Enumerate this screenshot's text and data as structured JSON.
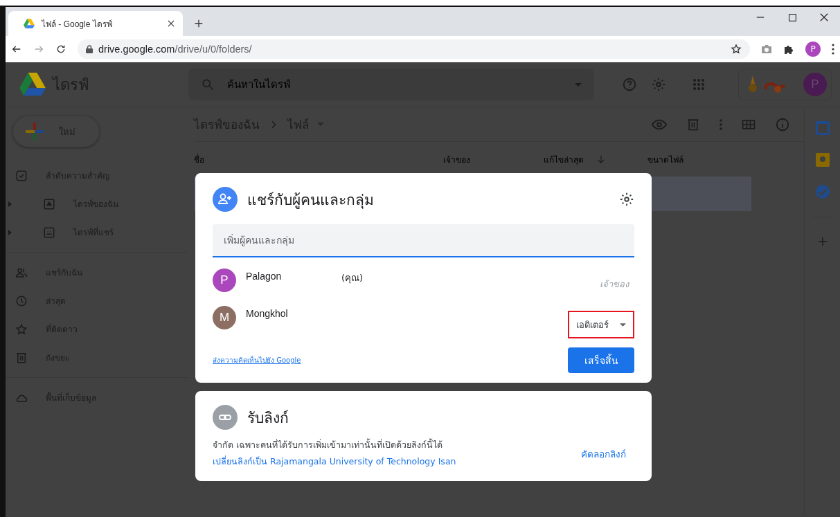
{
  "browser": {
    "tab_title": "ไฟล์ - Google ไดรฟ์",
    "url_host": "drive.google.com",
    "url_path": "/drive/u/0/folders/",
    "profile_initial": "P"
  },
  "app": {
    "logo_text": "ไดรฟ์",
    "search_placeholder": "ค้นหาในไดรฟ์",
    "account_initial": "P"
  },
  "new_button": "ใหม่",
  "sidebar": [
    [
      {
        "label": "ลำดับความสำคัญ",
        "kind": "priority",
        "expandable": false
      },
      {
        "label": "ไดรฟ์ของฉัน",
        "kind": "mydrive",
        "expandable": true
      },
      {
        "label": "ไดรฟ์ที่แชร์",
        "kind": "shared-drive",
        "expandable": true
      }
    ],
    [
      {
        "label": "แชร์กับฉัน",
        "kind": "people",
        "expandable": false
      },
      {
        "label": "ล่าสุด",
        "kind": "clock",
        "expandable": false
      },
      {
        "label": "ที่ติดดาว",
        "kind": "star",
        "expandable": false
      },
      {
        "label": "ถังขยะ",
        "kind": "trash",
        "expandable": false
      }
    ],
    [
      {
        "label": "พื้นที่เก็บข้อมูล",
        "kind": "cloud",
        "expandable": false
      }
    ]
  ],
  "breadcrumb": [
    "ไดรฟ์ของฉัน",
    "ไฟล์"
  ],
  "columns": [
    {
      "label": "ชื่อ",
      "sorted": false
    },
    {
      "label": "เจ้าของ",
      "sorted": false
    },
    {
      "label": "แก้ไขล่าสุด",
      "sorted": true
    },
    {
      "label": "ขนาดไฟล์",
      "sorted": false
    }
  ],
  "rows": [
    {
      "selected": true
    }
  ],
  "share_dialog": {
    "title": "แชร์กับผู้คนและกลุ่ม",
    "placeholder": "เพิ่มผู้คนและกลุ่ม",
    "people": [
      {
        "initial": "P",
        "name": "Palagon",
        "note": "(คุณ)",
        "color": "#ab47bc",
        "role": "เจ้าของ",
        "kind": "label",
        "highlighted": false
      },
      {
        "initial": "M",
        "name": "Mongkhol",
        "color": "#8d6e63",
        "role": "เอดิเตอร์",
        "kind": "dropdown",
        "highlighted": true
      }
    ],
    "feedback_link": "ส่งความคิดเห็นไปยัง Google",
    "done_button": "เสร็จสิ้น"
  },
  "link_dialog": {
    "title": "รับลิงก์",
    "description": "จำกัด เฉพาะคนที่ได้รับการเพิ่มเข้ามาเท่านั้นที่เปิดด้วยลิงก์นี้ได้",
    "change_link": "เปลี่ยนลิงก์เป็น Rajamangala University of Technology Isan",
    "copy_link": "คัดลอกลิงก์"
  }
}
